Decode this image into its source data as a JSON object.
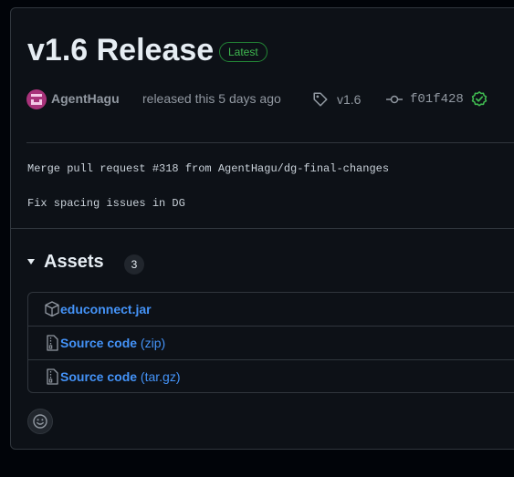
{
  "release": {
    "title": "v1.6 Release",
    "badge": "Latest",
    "author": "AgentHagu",
    "released_text": "released this 5 days ago",
    "tag": "v1.6",
    "commit": "f01f428",
    "body_lines": [
      "Merge pull request #318 from AgentHagu/dg-final-changes",
      "Fix spacing issues in DG"
    ]
  },
  "assets": {
    "label": "Assets",
    "count": "3",
    "items": [
      {
        "name": "educonnect.jar",
        "suffix": "",
        "icon": "package-icon"
      },
      {
        "name": "Source code",
        "suffix": "(zip)",
        "icon": "file-zip-icon"
      },
      {
        "name": "Source code",
        "suffix": "(tar.gz)",
        "icon": "file-zip-icon"
      }
    ]
  },
  "icons": {
    "tag": "tag-icon",
    "commit": "git-commit-icon",
    "verified": "check-circle-icon",
    "reaction": "smiley-icon"
  },
  "colors": {
    "background": "#0d1117",
    "link": "#4493f8",
    "success": "#3fb950",
    "muted": "#9198a1",
    "border": "#30363d"
  }
}
